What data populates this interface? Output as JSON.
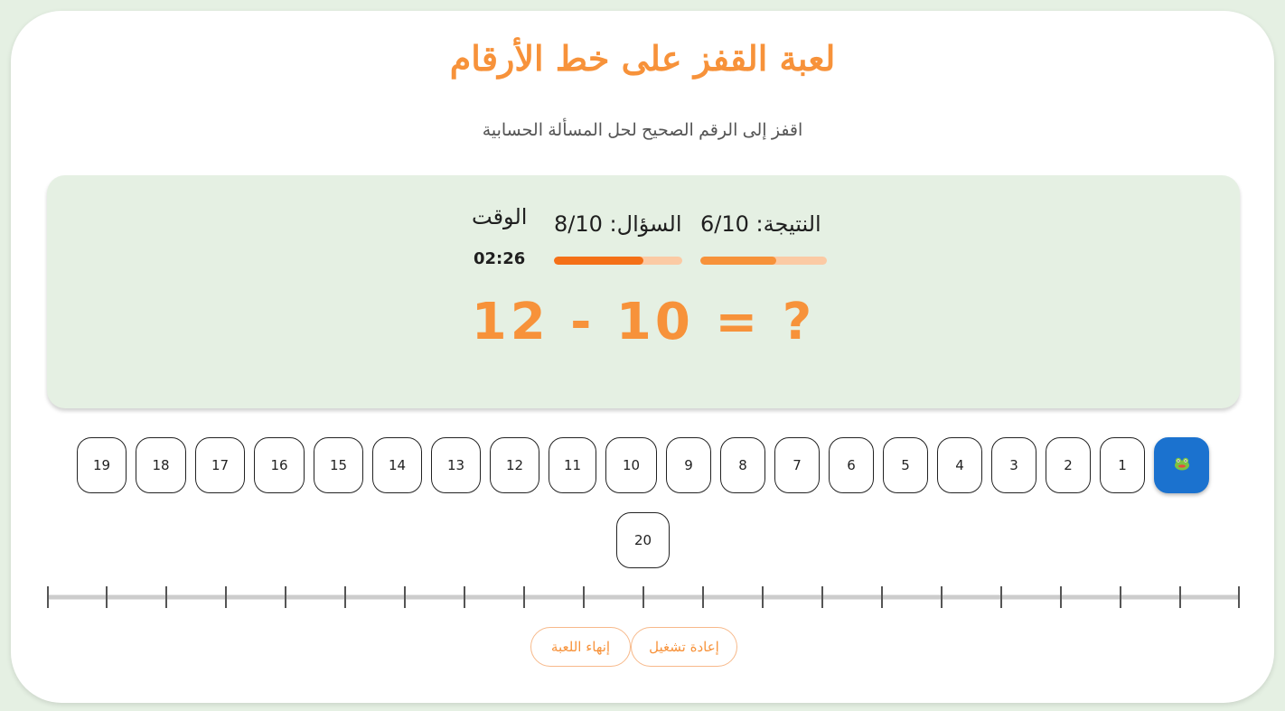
{
  "header": {
    "title": "لعبة القفز على خط الأرقام",
    "subtitle": "اقفز إلى الرقم الصحيح لحل المسألة الحسابية"
  },
  "stats": {
    "score_label": "النتيجة:",
    "score_value": "6/10",
    "score_fraction": 0.6,
    "question_label": "السؤال:",
    "question_value": "8/10",
    "question_fraction": 0.7,
    "time_label": "الوقت",
    "time_value": "02:26"
  },
  "equation": "12 - 10 = ?",
  "player_icon": "frog-icon",
  "tiles": [
    "1",
    "2",
    "3",
    "4",
    "5",
    "6",
    "7",
    "8",
    "9",
    "10",
    "11",
    "12",
    "13",
    "14",
    "15",
    "16",
    "17",
    "18",
    "19",
    "20"
  ],
  "buttons": {
    "restart": "إعادة تشغيل",
    "end": "إنهاء اللعبة"
  },
  "colors": {
    "accent": "#f7923a",
    "score_bar": "#f7923a",
    "question_bar": "#f47017",
    "bar_track": "#fbcaa4",
    "player_tile": "#1b72cf"
  }
}
